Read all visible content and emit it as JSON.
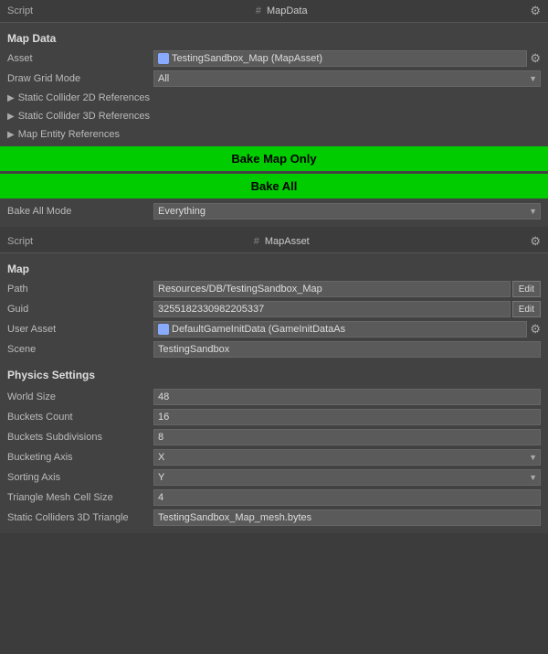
{
  "panels": {
    "script1": {
      "header": {
        "label": "Script",
        "name_prefix": "#",
        "name": "MapData"
      },
      "map_data_group": "Map Data",
      "fields": {
        "asset_label": "Asset",
        "asset_value": "TestingSandbox_Map (MapAsset)",
        "draw_grid_label": "Draw Grid Mode",
        "draw_grid_value": "All",
        "static_2d": "Static Collider 2D References",
        "static_3d": "Static Collider 3D References",
        "map_entity": "Map Entity References"
      },
      "buttons": {
        "bake_map_only": "Bake Map Only",
        "bake_all": "Bake All"
      },
      "bake_all_mode_label": "Bake All Mode",
      "bake_all_mode_value": "Everything"
    },
    "script2": {
      "header": {
        "label": "Script",
        "name_prefix": "#",
        "name": "MapAsset"
      },
      "map_group": "Map",
      "fields": {
        "path_label": "Path",
        "path_value": "Resources/DB/TestingSandbox_Map",
        "guid_label": "Guid",
        "guid_value": "3255182330982205337",
        "user_asset_label": "User Asset",
        "user_asset_value": "DefaultGameInitData (GameInitDataAs",
        "scene_label": "Scene",
        "scene_value": "TestingSandbox"
      },
      "physics_group": "Physics Settings",
      "physics": {
        "world_size_label": "World Size",
        "world_size_value": "48",
        "buckets_count_label": "Buckets Count",
        "buckets_count_value": "16",
        "buckets_subdivisions_label": "Buckets Subdivisions",
        "buckets_subdivisions_value": "8",
        "bucketing_axis_label": "Bucketing Axis",
        "bucketing_axis_value": "X",
        "sorting_axis_label": "Sorting Axis",
        "sorting_axis_value": "Y",
        "triangle_mesh_label": "Triangle Mesh Cell Size",
        "triangle_mesh_value": "4",
        "static_colliders_label": "Static Colliders 3D Triangle",
        "static_colliders_value": "TestingSandbox_Map_mesh.bytes"
      }
    }
  }
}
